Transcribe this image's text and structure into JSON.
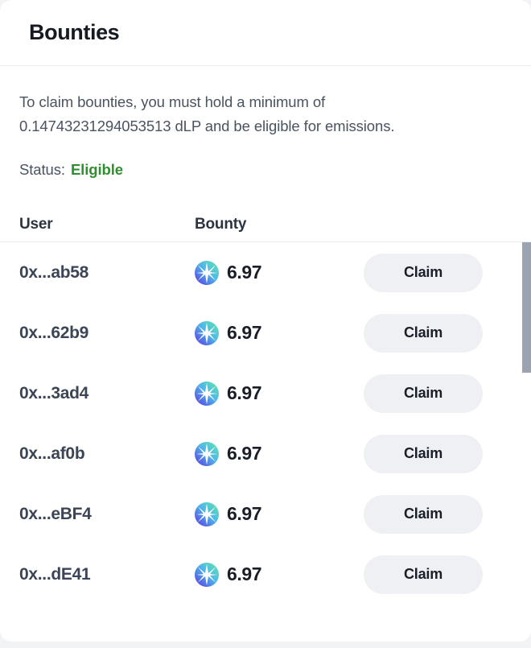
{
  "card": {
    "title": "Bounties"
  },
  "info": {
    "description_line1": "To claim bounties, you must hold a minimum of",
    "description_line2": "0.14743231294053513 dLP and be eligible for emissions.",
    "minimum_amount": "0.14743231294053513",
    "token_symbol": "dLP",
    "status_label": "Status:",
    "status_value": "Eligible",
    "status_color": "#2f8f2f"
  },
  "table": {
    "columns": [
      "User",
      "Bounty"
    ],
    "header_user": "User",
    "header_bounty": "Bounty",
    "rows": [
      {
        "user": "0x...ab58",
        "bounty": "6.97",
        "icon": "token-starburst-icon",
        "action": "Claim"
      },
      {
        "user": "0x...62b9",
        "bounty": "6.97",
        "icon": "token-starburst-icon",
        "action": "Claim"
      },
      {
        "user": "0x...3ad4",
        "bounty": "6.97",
        "icon": "token-starburst-icon",
        "action": "Claim"
      },
      {
        "user": "0x...af0b",
        "bounty": "6.97",
        "icon": "token-starburst-icon",
        "action": "Claim"
      },
      {
        "user": "0x...eBF4",
        "bounty": "6.97",
        "icon": "token-starburst-icon",
        "action": "Claim"
      },
      {
        "user": "0x...dE41",
        "bounty": "6.97",
        "icon": "token-starburst-icon",
        "action": "Claim"
      }
    ]
  },
  "colors": {
    "card_background": "#ffffff",
    "page_background": "#f2f3f5",
    "text_primary": "#191e28",
    "text_secondary": "#4a5360",
    "divider": "#ecedef",
    "button_background": "#eef0f4",
    "status_eligible": "#2f8f2f",
    "token_gradient_start": "#5fe3a1",
    "token_gradient_end": "#5b35e0",
    "scrollbar_thumb": "#9aa3af"
  }
}
